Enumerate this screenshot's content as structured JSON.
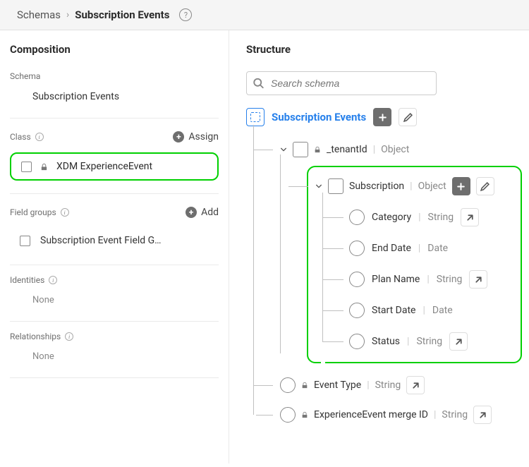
{
  "breadcrumb": {
    "root": "Schemas",
    "current": "Subscription Events"
  },
  "composition": {
    "title": "Composition",
    "schema_label": "Schema",
    "schema_name": "Subscription Events",
    "class_label": "Class",
    "assign_label": "Assign",
    "class_name": "XDM ExperienceEvent",
    "field_groups_label": "Field groups",
    "add_label": "Add",
    "field_group_name": "Subscription Event Field G…",
    "identities_label": "Identities",
    "identities_none": "None",
    "relationships_label": "Relationships",
    "relationships_none": "None"
  },
  "structure": {
    "title": "Structure",
    "search_placeholder": "Search schema",
    "root": "Subscription Events",
    "tenant": {
      "label": "_tenantId",
      "type": "Object"
    },
    "subscription": {
      "label": "Subscription",
      "type": "Object",
      "fields": [
        {
          "label": "Category",
          "type": "String",
          "link": true
        },
        {
          "label": "End Date",
          "type": "Date",
          "link": false
        },
        {
          "label": "Plan Name",
          "type": "String",
          "link": true
        },
        {
          "label": "Start Date",
          "type": "Date",
          "link": false
        },
        {
          "label": "Status",
          "type": "String",
          "link": true
        }
      ]
    },
    "event_type": {
      "label": "Event Type",
      "type": "String"
    },
    "merge_id": {
      "label": "ExperienceEvent merge ID",
      "type": "String"
    }
  }
}
